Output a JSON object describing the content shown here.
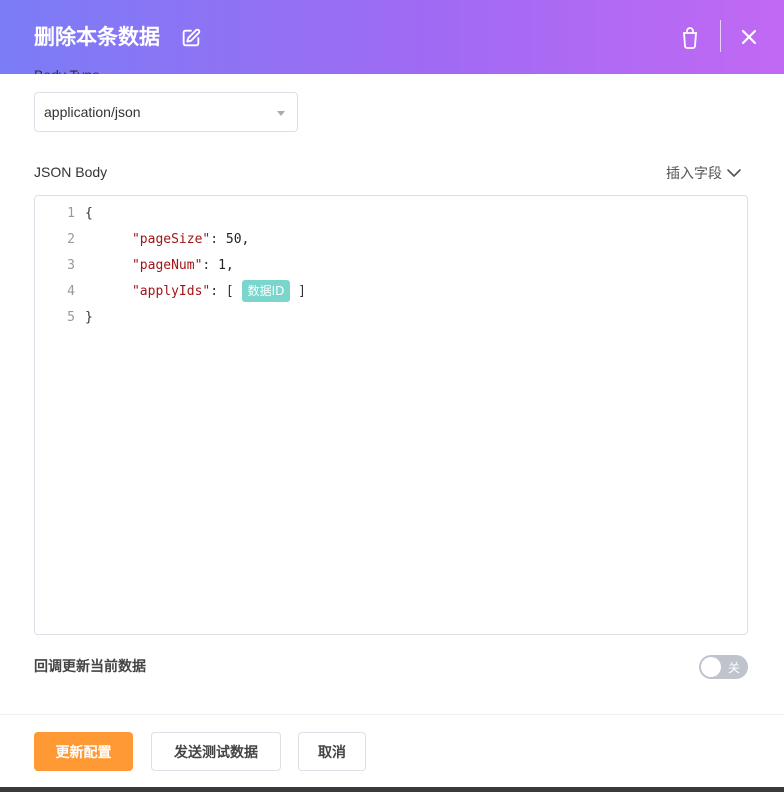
{
  "header": {
    "title": "删除本条数据"
  },
  "body_type": {
    "label": "Body Type",
    "selected": "application/json"
  },
  "json_body": {
    "label": "JSON Body",
    "insert_field": "插入字段",
    "lines": [
      {
        "num": "1"
      },
      {
        "num": "2",
        "key": "\"pageSize\"",
        "value": "50,"
      },
      {
        "num": "3",
        "key": "\"pageNum\"",
        "value": "1,"
      },
      {
        "num": "4",
        "key": "\"applyIds\"",
        "chip": "数据ID"
      },
      {
        "num": "5"
      }
    ]
  },
  "callback": {
    "label": "回调更新当前数据",
    "toggle_text": "关"
  },
  "footer": {
    "update_label": "更新配置",
    "test_label": "发送测试数据",
    "cancel_label": "取消"
  }
}
